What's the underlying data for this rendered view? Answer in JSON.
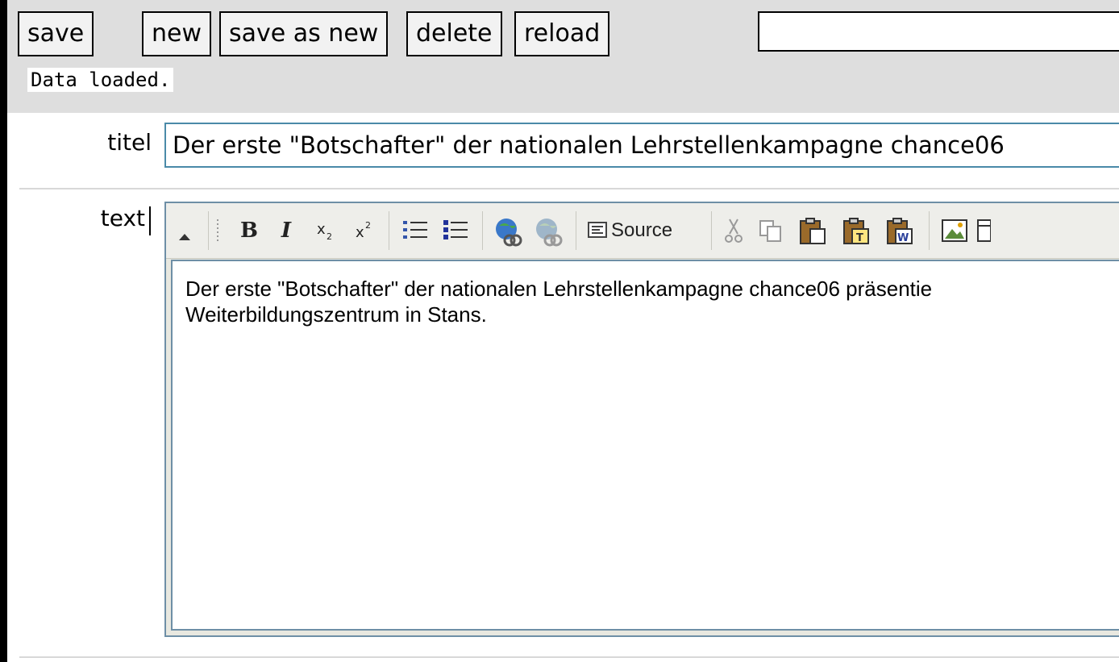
{
  "toolbar": {
    "save_label": "save",
    "new_label": "new",
    "save_as_new_label": "save as new",
    "delete_label": "delete",
    "reload_label": "reload",
    "search_value": ""
  },
  "status": {
    "message": "Data loaded."
  },
  "form": {
    "titel_label": "titel",
    "titel_value": "Der erste \"Botschafter\" der nationalen Lehrstellenkampagne chance06",
    "text_label": "text"
  },
  "editor": {
    "toolbar_icons": [
      "collapse-icon",
      "bold-icon",
      "italic-icon",
      "subscript-icon",
      "superscript-icon",
      "numbered-list-icon",
      "bulleted-list-icon",
      "link-icon",
      "unlink-icon",
      "source-icon",
      "cut-icon",
      "copy-icon",
      "paste-icon",
      "paste-text-icon",
      "paste-word-icon",
      "image-icon"
    ],
    "bold_glyph": "B",
    "italic_glyph": "I",
    "source_label": "Source",
    "content_line1": "Der erste \"Botschafter\" der nationalen Lehrstellenkampagne chance06 präsentie",
    "content_line2": "Weiterbildungszentrum in Stans."
  }
}
